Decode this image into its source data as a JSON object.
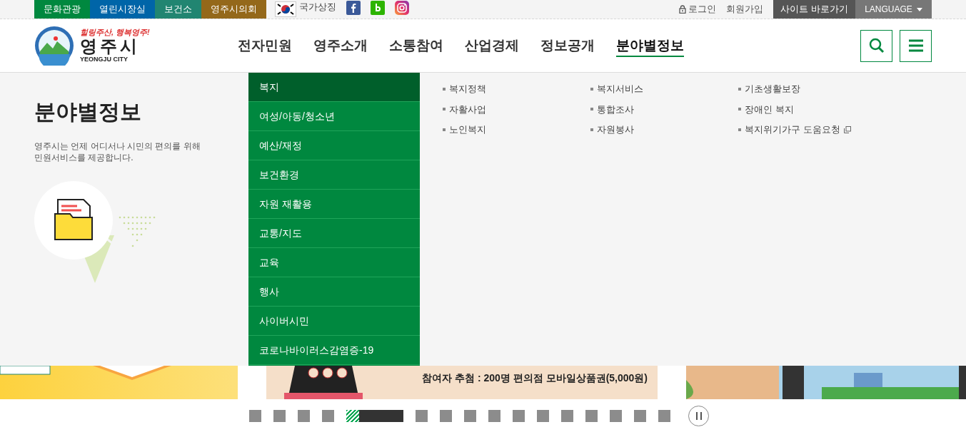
{
  "top_links": [
    {
      "label": "문화관광",
      "color": "#00883f"
    },
    {
      "label": "열린시장실",
      "color": "#0065a8"
    },
    {
      "label": "보건소",
      "color": "#218571"
    },
    {
      "label": "영주시의회",
      "color": "#94681a"
    }
  ],
  "national_symbol": "국가상징",
  "account_links": [
    "로그인",
    "회원가입"
  ],
  "site_shortcut": "사이트 바로가기",
  "language": "LANGUAGE",
  "logo": {
    "slogan": "힐링주산, 행복영주!",
    "name": "영주시",
    "english": "YEONGJU CITY"
  },
  "nav": [
    {
      "label": "전자민원",
      "selected": false
    },
    {
      "label": "영주소개",
      "selected": false
    },
    {
      "label": "소통참여",
      "selected": false
    },
    {
      "label": "산업경제",
      "selected": false
    },
    {
      "label": "정보공개",
      "selected": false
    },
    {
      "label": "분야별정보",
      "selected": true
    }
  ],
  "mega_menu": {
    "title": "분야별정보",
    "description": "영주시는 언제 어디서나 시민의 편의를 위해 민원서비스를 제공합니다.",
    "categories": [
      {
        "label": "복지",
        "selected": true
      },
      {
        "label": "여성/아동/청소년",
        "selected": false
      },
      {
        "label": "예산/재정",
        "selected": false
      },
      {
        "label": "보건환경",
        "selected": false
      },
      {
        "label": "자원 재활용",
        "selected": false
      },
      {
        "label": "교통/지도",
        "selected": false
      },
      {
        "label": "교육",
        "selected": false
      },
      {
        "label": "행사",
        "selected": false
      },
      {
        "label": "사이버시민",
        "selected": false
      },
      {
        "label": "코로나바이러스감염증-19",
        "selected": false
      }
    ],
    "links": [
      {
        "label": "복지정책",
        "external": false
      },
      {
        "label": "복지서비스",
        "external": false
      },
      {
        "label": "기초생활보장",
        "external": false
      },
      {
        "label": "자활사업",
        "external": false
      },
      {
        "label": "통합조사",
        "external": false
      },
      {
        "label": "장애인 복지",
        "external": false
      },
      {
        "label": "노인복지",
        "external": false
      },
      {
        "label": "자원봉사",
        "external": false
      },
      {
        "label": "복지위기가구 도움요청",
        "external": true
      }
    ]
  },
  "banner_text": "참여자 추첨 : 200명 편의점 모바일상품권(5,000원)",
  "slides": [
    {
      "selected": false
    },
    {
      "selected": false
    },
    {
      "selected": false
    },
    {
      "selected": false
    },
    {
      "selected": true,
      "level": 0.22
    },
    {
      "selected": false
    },
    {
      "selected": false
    },
    {
      "selected": false
    },
    {
      "selected": false
    },
    {
      "selected": false
    },
    {
      "selected": false
    },
    {
      "selected": false
    },
    {
      "selected": false
    },
    {
      "selected": false
    },
    {
      "selected": false
    },
    {
      "selected": false
    }
  ]
}
